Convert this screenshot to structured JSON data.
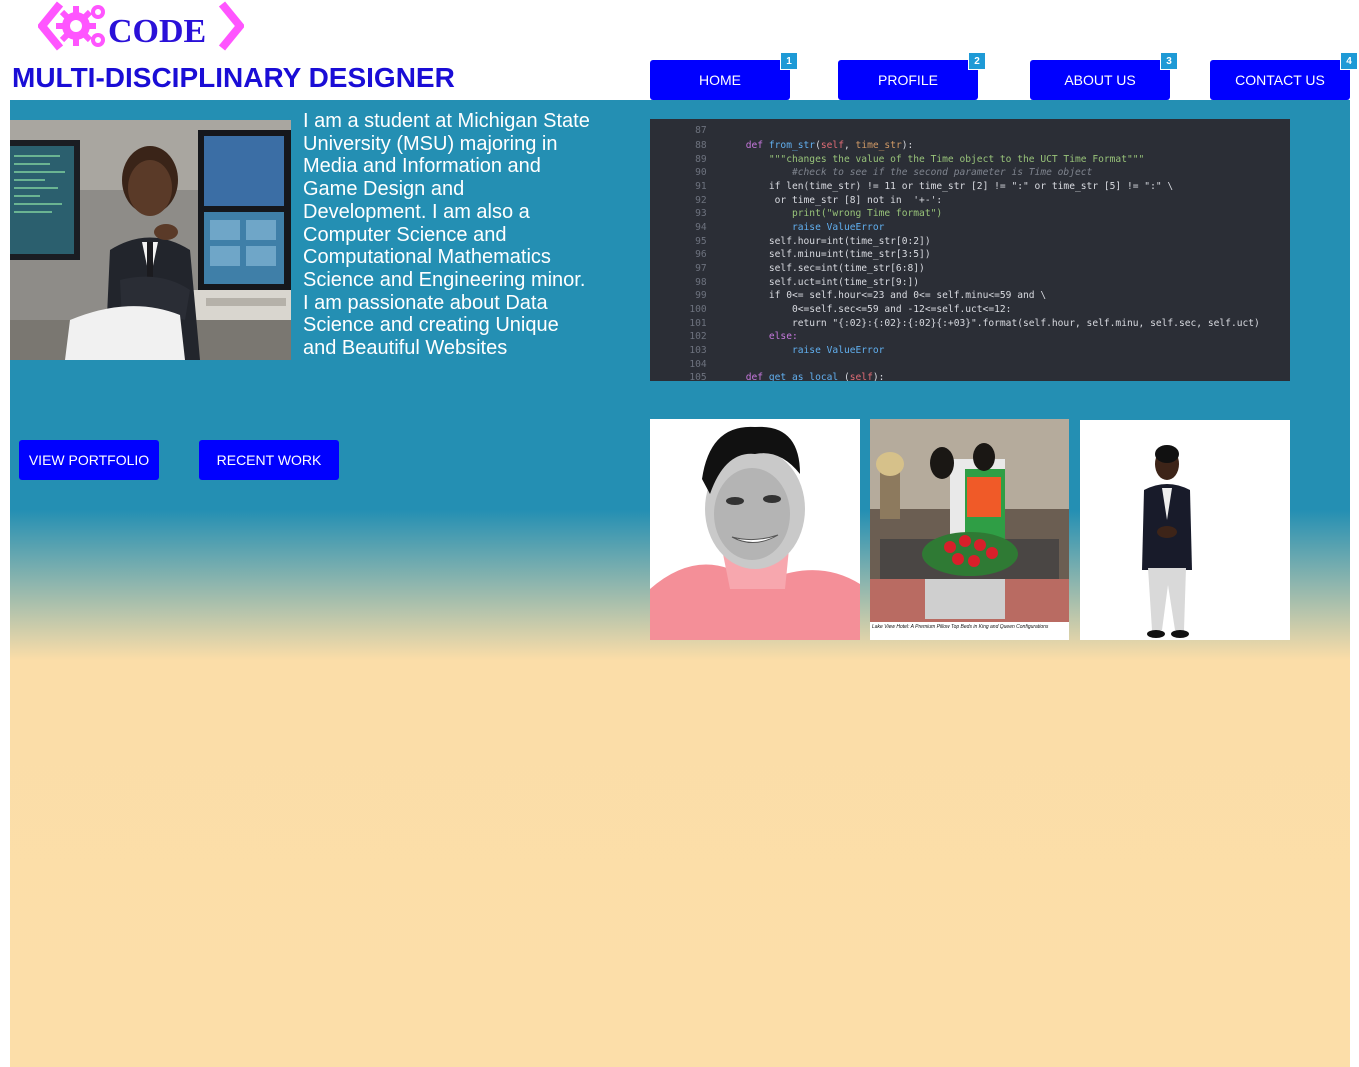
{
  "brand": {
    "logo_text": "CODE",
    "logo_color": "#ff55ff",
    "title": "MULTI-DISCIPLINARY DESIGNER"
  },
  "nav": {
    "items": [
      {
        "label": "HOME",
        "badge": "1"
      },
      {
        "label": "PROFILE",
        "badge": "2"
      },
      {
        "label": "ABOUT US",
        "badge": "3"
      },
      {
        "label": "CONTACT US",
        "badge": "4"
      }
    ]
  },
  "bio": {
    "text": "I am a student at Michigan State University (MSU) majoring in Media and Information and Game Design and Development. I am also a Computer Science  and Computational Mathematics Science and Engineering minor. I am passionate about Data Science and creating Unique and Beautiful Websites"
  },
  "actions": {
    "portfolio_label": "VIEW PORTFOLIO",
    "recent_label": "RECENT WORK"
  },
  "code": {
    "lines": [
      {
        "n": "87",
        "t": ""
      },
      {
        "n": "88",
        "t": "    def from_str(self, time_str):"
      },
      {
        "n": "89",
        "t": "        \"\"\"changes the value of the Time object to the UCT Time Format\"\"\""
      },
      {
        "n": "90",
        "t": "            #check to see if the second parameter is Time object"
      },
      {
        "n": "91",
        "t": "        if len(time_str) != 11 or time_str [2] != \":\" or time_str [5] != \":\" \\"
      },
      {
        "n": "92",
        "t": "         or time_str [8] not in  '+-':"
      },
      {
        "n": "93",
        "t": "            print(\"wrong Time format\")"
      },
      {
        "n": "94",
        "t": "            raise ValueError"
      },
      {
        "n": "95",
        "t": "        self.hour=int(time_str[0:2])"
      },
      {
        "n": "96",
        "t": "        self.minu=int(time_str[3:5])"
      },
      {
        "n": "97",
        "t": "        self.sec=int(time_str[6:8])"
      },
      {
        "n": "98",
        "t": "        self.uct=int(time_str[9:])"
      },
      {
        "n": "99",
        "t": "        if 0<= self.hour<=23 and 0<= self.minu<=59 and \\"
      },
      {
        "n": "100",
        "t": "            0<=self.sec<=59 and -12<=self.uct<=12:"
      },
      {
        "n": "101",
        "t": "            return \"{:02}:{:02}:{:02}{:+03}\".format(self.hour, self.minu, self.sec, self.uct)"
      },
      {
        "n": "102",
        "t": "        else:"
      },
      {
        "n": "103",
        "t": "            raise ValueError"
      },
      {
        "n": "104",
        "t": ""
      },
      {
        "n": "105",
        "t": "    def get_as_local (self):"
      }
    ]
  },
  "gallery": {
    "caption": "Lake View Hotel: A Premium Pillow Top Beds in King and Queen Configurations"
  },
  "colors": {
    "nav_button": "#0000ff",
    "title": "#1a0dd6",
    "band": "#248fb3",
    "sand": "#fcdea9",
    "badge": "#1e9ad6"
  }
}
